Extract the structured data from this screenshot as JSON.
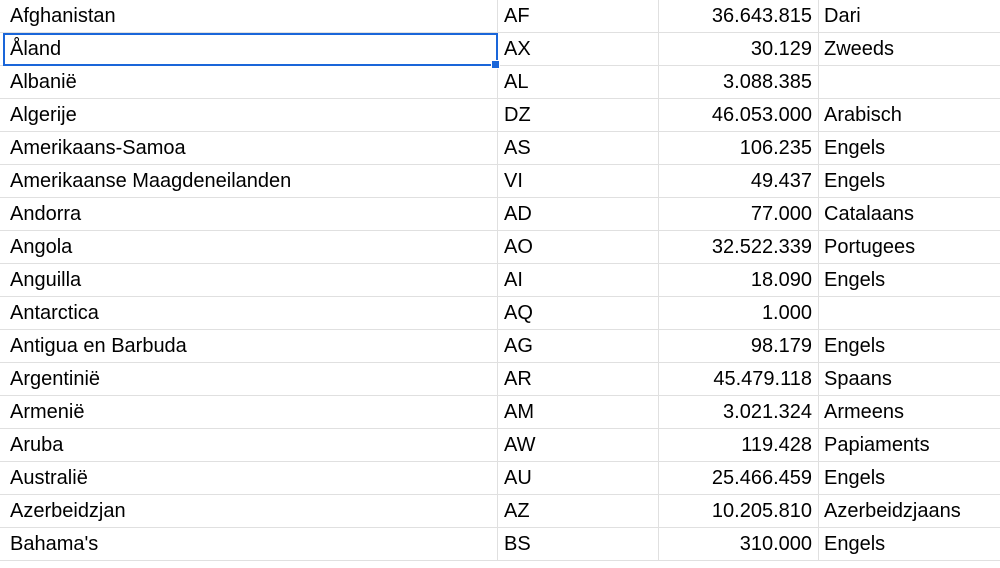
{
  "selection": {
    "row_index": 1,
    "column": "name"
  },
  "rows": [
    {
      "name": "Afghanistan",
      "code": "AF",
      "population": "36.643.815",
      "language": "Dari"
    },
    {
      "name": "Åland",
      "code": "AX",
      "population": "30.129",
      "language": "Zweeds"
    },
    {
      "name": "Albanië",
      "code": "AL",
      "population": "3.088.385",
      "language": ""
    },
    {
      "name": "Algerije",
      "code": "DZ",
      "population": "46.053.000",
      "language": "Arabisch"
    },
    {
      "name": "Amerikaans-Samoa",
      "code": "AS",
      "population": "106.235",
      "language": "Engels"
    },
    {
      "name": "Amerikaanse Maagdeneilanden",
      "code": "VI",
      "population": "49.437",
      "language": "Engels"
    },
    {
      "name": "Andorra",
      "code": "AD",
      "population": "77.000",
      "language": "Catalaans"
    },
    {
      "name": "Angola",
      "code": "AO",
      "population": "32.522.339",
      "language": "Portugees"
    },
    {
      "name": "Anguilla",
      "code": "AI",
      "population": "18.090",
      "language": "Engels"
    },
    {
      "name": "Antarctica",
      "code": "AQ",
      "population": "1.000",
      "language": ""
    },
    {
      "name": "Antigua en Barbuda",
      "code": "AG",
      "population": "98.179",
      "language": "Engels"
    },
    {
      "name": "Argentinië",
      "code": "AR",
      "population": "45.479.118",
      "language": "Spaans"
    },
    {
      "name": "Armenië",
      "code": "AM",
      "population": "3.021.324",
      "language": "Armeens"
    },
    {
      "name": "Aruba",
      "code": "AW",
      "population": "119.428",
      "language": "Papiaments"
    },
    {
      "name": "Australië",
      "code": "AU",
      "population": "25.466.459",
      "language": "Engels"
    },
    {
      "name": "Azerbeidzjan",
      "code": "AZ",
      "population": "10.205.810",
      "language": "Azerbeidzjaans"
    },
    {
      "name": "Bahama's",
      "code": "BS",
      "population": "310.000",
      "language": "Engels"
    }
  ]
}
